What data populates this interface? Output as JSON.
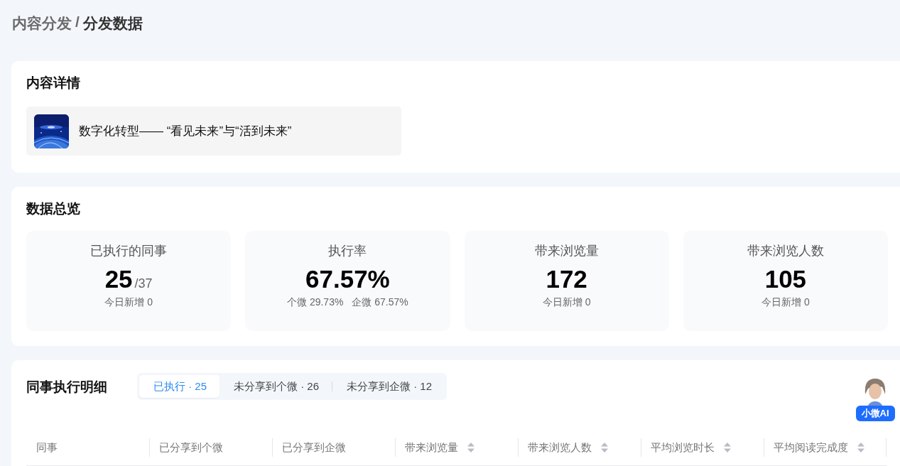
{
  "breadcrumb": {
    "parent": "内容分发",
    "separator": "/",
    "current": "分发数据"
  },
  "content_detail": {
    "title": "内容详情",
    "item": {
      "title": "数字化转型—— “看见未来”与“活到未来”"
    }
  },
  "overview": {
    "title": "数据总览",
    "stats": [
      {
        "kind": "fraction",
        "label": "已执行的同事",
        "value": "25",
        "total": "/37",
        "notes": [
          "今日新增 0"
        ]
      },
      {
        "kind": "plain",
        "label": "执行率",
        "value": "67.57%",
        "notes": [
          "个微 29.73%",
          "企微 67.57%"
        ]
      },
      {
        "kind": "plain",
        "label": "带来浏览量",
        "value": "172",
        "notes": [
          "今日新增 0"
        ]
      },
      {
        "kind": "plain",
        "label": "带来浏览人数",
        "value": "105",
        "notes": [
          "今日新增 0"
        ]
      }
    ]
  },
  "details": {
    "title": "同事执行明细",
    "tabs": [
      {
        "label": "已执行 · 25",
        "selected": true
      },
      {
        "label": "未分享到个微 · 26",
        "selected": false
      },
      {
        "label": "未分享到企微 · 12",
        "selected": false
      }
    ],
    "columns": [
      {
        "label": "同事",
        "sortable": false
      },
      {
        "label": "已分享到个微",
        "sortable": false
      },
      {
        "label": "已分享到企微",
        "sortable": false
      },
      {
        "label": "带来浏览量",
        "sortable": true
      },
      {
        "label": "带来浏览人数",
        "sortable": true
      },
      {
        "label": "平均浏览时长",
        "sortable": true
      },
      {
        "label": "平均阅读完成度",
        "sortable": true
      }
    ]
  },
  "assistant": {
    "label": "小微AI"
  }
}
